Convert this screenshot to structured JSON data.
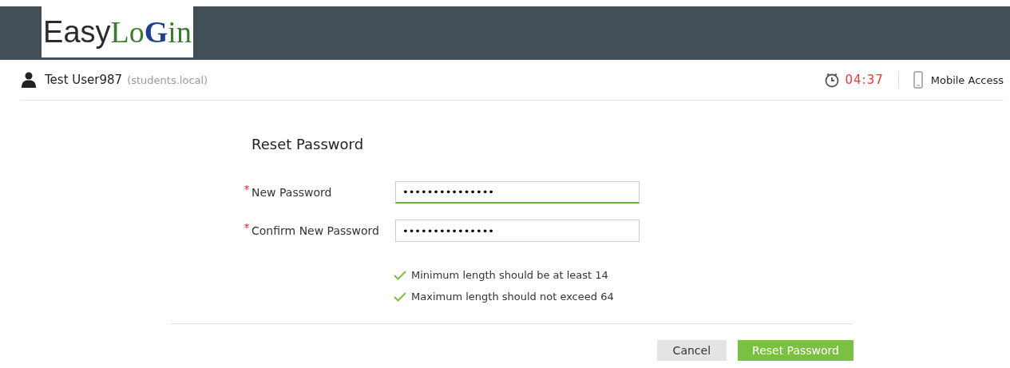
{
  "logo": [
    {
      "text": "Easy",
      "color": "#2b2b2b"
    },
    {
      "text": "Lo",
      "color": "#3c7a2e"
    },
    {
      "text": "G",
      "color": "#1f3f8f"
    },
    {
      "text": "in",
      "color": "#3c7a2e"
    }
  ],
  "user": {
    "name": "Test User987",
    "domain": "(students.local)"
  },
  "timer": "04:37",
  "mobile_access": "Mobile Access",
  "form": {
    "title": "Reset Password",
    "fields": [
      {
        "label": "New Password",
        "required": true,
        "value": "•••••••••••••••",
        "focused": true
      },
      {
        "label": "Confirm New Password",
        "required": true,
        "value": "•••••••••••••••",
        "focused": false
      }
    ],
    "rules": [
      {
        "text": "Minimum length should be at least 14",
        "met": true
      },
      {
        "text": "Maximum length should not exceed 64",
        "met": true
      }
    ]
  },
  "buttons": [
    {
      "label": "Cancel",
      "kind": "secondary"
    },
    {
      "label": "Reset Password",
      "kind": "primary"
    }
  ]
}
